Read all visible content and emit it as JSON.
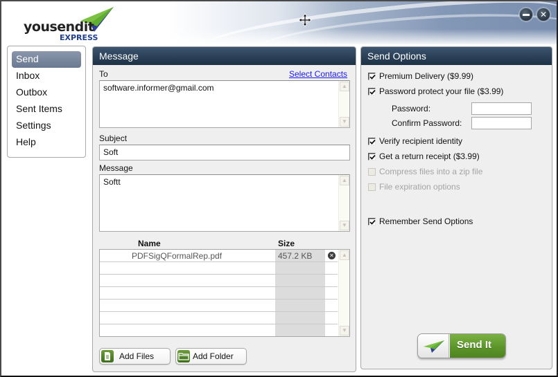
{
  "app": {
    "brand_prefix": "yousendit",
    "brand_suffix": "EXPRESS",
    "window_controls": {
      "minimize": "minimize",
      "close": "close"
    }
  },
  "nav": {
    "items": [
      {
        "label": "Send",
        "active": true
      },
      {
        "label": "Inbox",
        "active": false
      },
      {
        "label": "Outbox",
        "active": false
      },
      {
        "label": "Sent Items",
        "active": false
      },
      {
        "label": "Settings",
        "active": false
      },
      {
        "label": "Help",
        "active": false
      }
    ]
  },
  "message_panel": {
    "title": "Message",
    "to_label": "To",
    "select_contacts": "Select Contacts",
    "to_value": "software.informer@gmail.com",
    "subject_label": "Subject",
    "subject_value": "Soft",
    "message_label": "Message",
    "message_value": "Softt",
    "files": {
      "columns": {
        "name": "Name",
        "size": "Size"
      },
      "rows": [
        {
          "name": "PDFSigQFormalRep.pdf",
          "size": "457.2 KB"
        }
      ]
    },
    "add_files": "Add Files",
    "add_folder": "Add Folder"
  },
  "options_panel": {
    "title": "Send Options",
    "options": [
      {
        "label": "Premium Delivery ($9.99)",
        "checked": true,
        "enabled": true
      },
      {
        "label": "Password protect your file ($3.99)",
        "checked": true,
        "enabled": true
      },
      {
        "label": "Verify recipient identity",
        "checked": true,
        "enabled": true
      },
      {
        "label": "Get a return receipt ($3.99)",
        "checked": true,
        "enabled": true
      },
      {
        "label": "Compress files into a zip file",
        "checked": false,
        "enabled": false
      },
      {
        "label": "File expiration options",
        "checked": false,
        "enabled": false
      },
      {
        "label": "Remember Send Options",
        "checked": true,
        "enabled": true
      }
    ],
    "password_label": "Password:",
    "confirm_password_label": "Confirm Password:",
    "password_value": "",
    "confirm_password_value": "",
    "send_button": "Send It"
  },
  "colors": {
    "panel_header": "#2c4259",
    "nav_active": "#6a7891",
    "send_green": "#5c9629",
    "link": "#1a1aee"
  }
}
